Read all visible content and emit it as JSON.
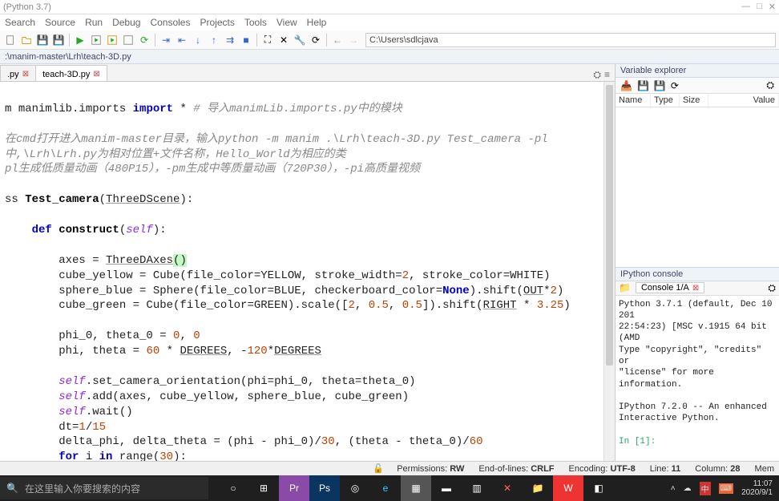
{
  "title": "(Python 3.7)",
  "menu": [
    "Search",
    "Source",
    "Run",
    "Debug",
    "Consoles",
    "Projects",
    "Tools",
    "View",
    "Help"
  ],
  "path": "C:\\Users\\sdlcjava",
  "crumb": ":\\manim-master\\Lrh\\teach-3D.py",
  "tabs": [
    {
      "label": ".py",
      "close": true
    },
    {
      "label": "teach-3D.py",
      "close": true,
      "active": true
    }
  ],
  "code": {
    "l1_a": "m ",
    "l1_b": "manimlib.imports ",
    "l1_c": "import",
    "l1_d": " * ",
    "l1_cmt": "# 导入manimLib.imports.py中的模块",
    "blank": "",
    "l3": "在cmd打开进入manim-master目录，输入python -m manim .\\Lrh\\teach-3D.py Test_camera -pl",
    "l4": "中,\\Lrh\\Lrh.py为相对位置+文件名称，Hello_World为相应的类",
    "l5": "pl生成低质量动画（480P15），-pm生成中等质量动画（720P30），-pi高质量视频",
    "l7_a": "ss ",
    "l7_b": "Test_camera",
    "l7_c": "(",
    "l7_d": "ThreeDScene",
    "l7_e": "):",
    "l9_a": "    def ",
    "l9_b": "construct",
    "l9_c": "(",
    "l9_self": "self",
    "l9_d": "):",
    "l11_a": "        axes = ",
    "l11_b": "ThreeDAxes",
    "l11_p1": "(",
    "l11_p2": ")",
    "l12": "        cube_yellow = Cube(file_color=YELLOW, stroke_width=",
    "l12_n": "2",
    "l12_b": ", stroke_color=WHITE)",
    "l13_a": "        sphere_blue = Sphere(file_color=BLUE, checkerboard_color=",
    "l13_none": "None",
    "l13_b": ").shift(",
    "l13_c": "OUT",
    "l13_d": "*",
    "l13_n": "2",
    "l13_e": ")",
    "l14_a": "        cube_green = Cube(file_color=GREEN).scale([",
    "l14_n1": "2",
    "l14_b": ", ",
    "l14_n2": "0.5",
    "l14_c": ", ",
    "l14_n3": "0.5",
    "l14_d": "]).shift(",
    "l14_e": "RIGHT",
    "l14_f": " * ",
    "l14_n4": "3.25",
    "l14_g": ")",
    "l16_a": "        phi_0, theta_0 = ",
    "l16_n1": "0",
    "l16_b": ", ",
    "l16_n2": "0",
    "l17_a": "        phi, theta = ",
    "l17_n1": "60",
    "l17_b": " * ",
    "l17_c": "DEGREES",
    "l17_d": ", -",
    "l17_n2": "120",
    "l17_e": "*",
    "l17_f": "DEGREES",
    "l19_a": "        ",
    "l19_self": "self",
    "l19_b": ".set_camera_orientation(phi=phi_0, theta=theta_0)",
    "l20_a": "        ",
    "l20_self": "self",
    "l20_b": ".add(axes, cube_yellow, sphere_blue, cube_green)",
    "l21_a": "        ",
    "l21_self": "self",
    "l21_b": ".wait()",
    "l22_a": "        dt=",
    "l22_n1": "1",
    "l22_b": "/",
    "l22_n2": "15",
    "l23_a": "        delta_phi, delta_theta = (phi - phi_0)/",
    "l23_n1": "30",
    "l23_b": ", (theta - theta_0)/",
    "l23_n2": "60",
    "l24_a": "        ",
    "l24_for": "for",
    "l24_b": " i ",
    "l24_in": "in",
    "l24_c": " range(",
    "l24_n": "30",
    "l24_d": "):"
  },
  "var_panel": {
    "title": "Variable explorer",
    "cols": [
      "Name",
      "Type",
      "Size",
      "Value"
    ]
  },
  "console": {
    "title": "IPython console",
    "tab": "Console 1/A",
    "line1": "Python 3.7.1 (default, Dec 10 201",
    "line2": "22:54:23) [MSC v.1915 64 bit (AMD",
    "line3": "Type \"copyright\", \"credits\" or",
    "line4": "\"license\" for more information.",
    "line5": "IPython 7.2.0 -- An enhanced",
    "line6": "Interactive Python.",
    "prompt": "In [1]:"
  },
  "status": {
    "perm_l": "Permissions:",
    "perm_v": "RW",
    "eol_l": "End-of-lines:",
    "eol_v": "CRLF",
    "enc_l": "Encoding:",
    "enc_v": "UTF-8",
    "line_l": "Line:",
    "line_v": "11",
    "col_l": "Column:",
    "col_v": "28",
    "mem": "Mem"
  },
  "taskbar": {
    "search_placeholder": "在这里输入你要搜索的内容",
    "time": "11:07",
    "date": "2020/9/1"
  }
}
